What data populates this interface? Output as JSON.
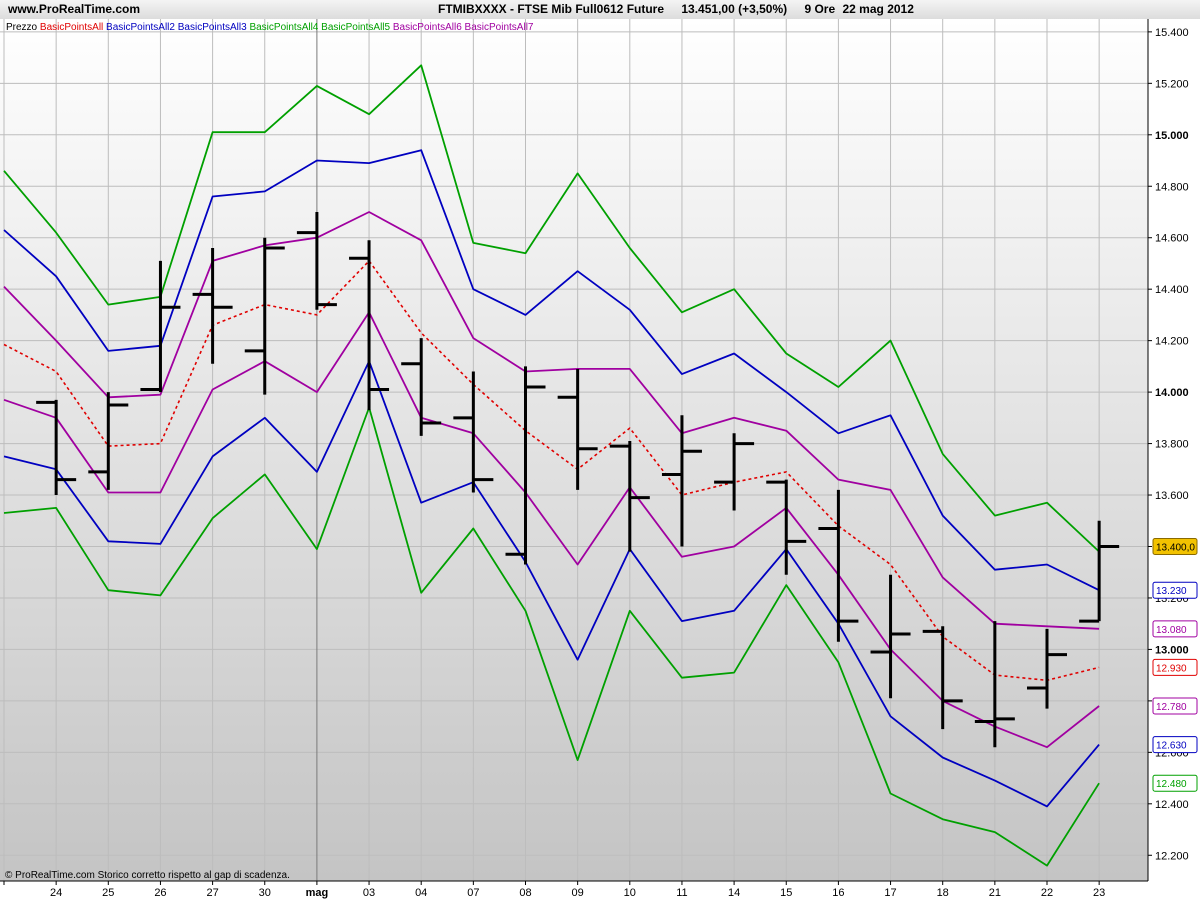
{
  "header": {
    "brand": "www.ProRealTime.com",
    "symbol": "FTMIBXXXX - FTSE Mib Full0612 Future",
    "price": "13.451,00 (+3,50%)",
    "timeframe": "9 Ore",
    "date": "22 mag 2012"
  },
  "legend": [
    {
      "label": "Prezzo",
      "color": "#000000"
    },
    {
      "label": "BasicPointsAll",
      "color": "#e00000"
    },
    {
      "label": "BasicPointsAll2",
      "color": "#0000c0"
    },
    {
      "label": "BasicPointsAll3",
      "color": "#0000c0"
    },
    {
      "label": "BasicPointsAll4",
      "color": "#00a000"
    },
    {
      "label": "BasicPointsAll5",
      "color": "#00a000"
    },
    {
      "label": "BasicPointsAll6",
      "color": "#a000a0"
    },
    {
      "label": "BasicPointsAll7",
      "color": "#a000a0"
    }
  ],
  "footer": "© ProRealTime.com  Storico corretto rispetto al gap di scadenza.",
  "chart_data": {
    "type": "line",
    "ylim": [
      12100,
      15450
    ],
    "yticks": [
      {
        "value": 12200,
        "label": "12.200",
        "bold": false
      },
      {
        "value": 12400,
        "label": "12.400",
        "bold": false
      },
      {
        "value": 12600,
        "label": "12.600",
        "bold": false
      },
      {
        "value": 12800,
        "label": "12.800",
        "bold": false
      },
      {
        "value": 13000,
        "label": "13.000",
        "bold": true
      },
      {
        "value": 13200,
        "label": "13.200",
        "bold": false
      },
      {
        "value": 13400,
        "label": "13.400",
        "bold": false
      },
      {
        "value": 13600,
        "label": "13.600",
        "bold": false
      },
      {
        "value": 13800,
        "label": "13.800",
        "bold": false
      },
      {
        "value": 14000,
        "label": "14.000",
        "bold": true
      },
      {
        "value": 14200,
        "label": "14.200",
        "bold": false
      },
      {
        "value": 14400,
        "label": "14.400",
        "bold": false
      },
      {
        "value": 14600,
        "label": "14.600",
        "bold": false
      },
      {
        "value": 14800,
        "label": "14.800",
        "bold": false
      },
      {
        "value": 15000,
        "label": "15.000",
        "bold": true
      },
      {
        "value": 15200,
        "label": "15.200",
        "bold": false
      },
      {
        "value": 15400,
        "label": "15.400",
        "bold": false
      }
    ],
    "x_labels": [
      "",
      "24",
      "25",
      "26",
      "27",
      "30",
      "mag",
      "03",
      "04",
      "07",
      "08",
      "09",
      "10",
      "11",
      "14",
      "15",
      "16",
      "17",
      "18",
      "21",
      "22",
      "23"
    ],
    "x_bold_index": 6,
    "series": [
      {
        "name": "BasicPointsAll",
        "color": "#e00000",
        "dashed": true,
        "values": [
          14185,
          14080,
          13790,
          13800,
          14260,
          14340,
          14300,
          14510,
          14230,
          14030,
          13850,
          13700,
          13860,
          13600,
          13650,
          13690,
          13480,
          13330,
          13050,
          12900,
          12880,
          12930
        ]
      },
      {
        "name": "BasicPointsAll2",
        "color": "#0000c0",
        "dashed": false,
        "values": [
          14630,
          14450,
          14160,
          14180,
          14760,
          14780,
          14900,
          14890,
          14940,
          14400,
          14300,
          14470,
          14320,
          14070,
          14150,
          14000,
          13840,
          13910,
          13520,
          13310,
          13330,
          13230
        ]
      },
      {
        "name": "BasicPointsAll3",
        "color": "#0000c0",
        "dashed": false,
        "values": [
          13750,
          13700,
          13420,
          13410,
          13750,
          13900,
          13690,
          14120,
          13570,
          13650,
          13340,
          12960,
          13390,
          13110,
          13150,
          13390,
          13100,
          12740,
          12580,
          12490,
          12390,
          12630
        ]
      },
      {
        "name": "BasicPointsAll4",
        "color": "#00a000",
        "dashed": false,
        "values": [
          14860,
          14620,
          14340,
          14370,
          15010,
          15010,
          15190,
          15080,
          15270,
          14580,
          14540,
          14850,
          14560,
          14310,
          14400,
          14150,
          14020,
          14200,
          13760,
          13520,
          13570,
          13380
        ]
      },
      {
        "name": "BasicPointsAll5",
        "color": "#00a000",
        "dashed": false,
        "values": [
          13530,
          13550,
          13230,
          13210,
          13510,
          13680,
          13390,
          13940,
          13220,
          13470,
          13150,
          12570,
          13150,
          12890,
          12910,
          13250,
          12950,
          12440,
          12340,
          12290,
          12160,
          12480
        ]
      },
      {
        "name": "BasicPointsAll6",
        "color": "#a000a0",
        "dashed": false,
        "values": [
          14410,
          14200,
          13980,
          13990,
          14510,
          14570,
          14600,
          14700,
          14590,
          14210,
          14080,
          14090,
          14090,
          13840,
          13900,
          13850,
          13660,
          13620,
          13280,
          13100,
          13090,
          13080
        ]
      },
      {
        "name": "BasicPointsAll7",
        "color": "#a000a0",
        "dashed": false,
        "values": [
          13970,
          13900,
          13610,
          13610,
          14010,
          14120,
          14000,
          14310,
          13900,
          13840,
          13610,
          13330,
          13630,
          13360,
          13400,
          13550,
          13290,
          13000,
          12800,
          12700,
          12620,
          12780
        ]
      }
    ],
    "price_bars": [
      {
        "high": 13970,
        "low": 13600,
        "open": 13960,
        "close": 13660
      },
      {
        "high": 14000,
        "low": 13620,
        "open": 13690,
        "close": 13950
      },
      {
        "high": 14510,
        "low": 14000,
        "open": 14010,
        "close": 14330
      },
      {
        "high": 14560,
        "low": 14110,
        "open": 14380,
        "close": 14330
      },
      {
        "high": 14600,
        "low": 13990,
        "open": 14160,
        "close": 14560
      },
      {
        "high": 14700,
        "low": 14320,
        "open": 14620,
        "close": 14340
      },
      {
        "high": 14590,
        "low": 13930,
        "open": 14520,
        "close": 14010
      },
      {
        "high": 14210,
        "low": 13830,
        "open": 14110,
        "close": 13880
      },
      {
        "high": 14080,
        "low": 13610,
        "open": 13900,
        "close": 13660
      },
      {
        "high": 14100,
        "low": 13330,
        "open": 13370,
        "close": 14020
      },
      {
        "high": 14090,
        "low": 13620,
        "open": 13980,
        "close": 13780
      },
      {
        "high": 13810,
        "low": 13380,
        "open": 13790,
        "close": 13590
      },
      {
        "high": 13910,
        "low": 13400,
        "open": 13680,
        "close": 13770
      },
      {
        "high": 13840,
        "low": 13540,
        "open": 13650,
        "close": 13800
      },
      {
        "high": 13660,
        "low": 13290,
        "open": 13650,
        "close": 13420
      },
      {
        "high": 13620,
        "low": 13030,
        "open": 13470,
        "close": 13110
      },
      {
        "high": 13290,
        "low": 12810,
        "open": 12990,
        "close": 13060
      },
      {
        "high": 13090,
        "low": 12690,
        "open": 13070,
        "close": 12800
      },
      {
        "high": 13110,
        "low": 12620,
        "open": 12720,
        "close": 12730
      },
      {
        "high": 13080,
        "low": 12770,
        "open": 12850,
        "close": 12980
      },
      {
        "high": 13500,
        "low": 13110,
        "open": 13110,
        "close": 13400
      }
    ],
    "value_badges": [
      {
        "value": 13400,
        "label": "13.400,0",
        "color": "#000000",
        "bg": "#f2c200",
        "border": "#8a6a00"
      },
      {
        "value": 13230,
        "label": "13.230",
        "color": "#0000c0",
        "bg": "#ffffff",
        "border": "#0000c0"
      },
      {
        "value": 13080,
        "label": "13.080",
        "color": "#a000a0",
        "bg": "#ffffff",
        "border": "#a000a0"
      },
      {
        "value": 12930,
        "label": "12.930",
        "color": "#e00000",
        "bg": "#ffffff",
        "border": "#e00000"
      },
      {
        "value": 12780,
        "label": "12.780",
        "color": "#a000a0",
        "bg": "#ffffff",
        "border": "#a000a0"
      },
      {
        "value": 12630,
        "label": "12.630",
        "color": "#0000c0",
        "bg": "#ffffff",
        "border": "#0000c0"
      },
      {
        "value": 12480,
        "label": "12.480",
        "color": "#00a000",
        "bg": "#ffffff",
        "border": "#00a000"
      }
    ]
  }
}
